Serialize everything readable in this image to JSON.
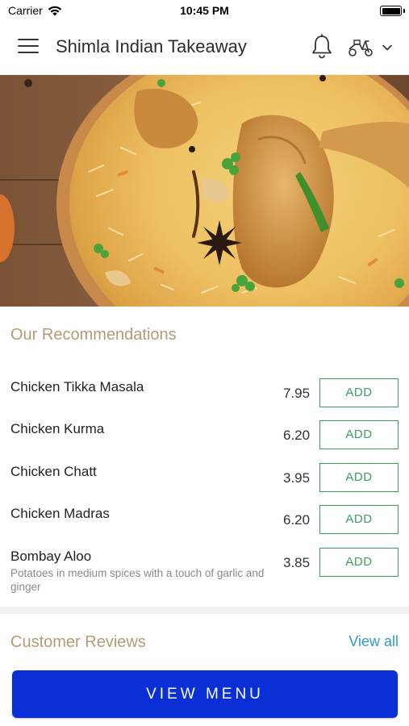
{
  "status_bar": {
    "carrier": "Carrier",
    "time": "10:45 PM"
  },
  "header": {
    "title": "Shimla Indian Takeaway",
    "icons": [
      "menu-icon",
      "bell-icon",
      "scooter-icon",
      "chevron-down-icon"
    ]
  },
  "hero": {
    "image": "chicken biryani dish"
  },
  "recommendations": {
    "title": "Our Recommendations",
    "add_label": "ADD",
    "items": [
      {
        "name": "Chicken Tikka Masala",
        "price": "7.95",
        "description": ""
      },
      {
        "name": "Chicken Kurma",
        "price": "6.20",
        "description": ""
      },
      {
        "name": "Chicken Chatt",
        "price": "3.95",
        "description": ""
      },
      {
        "name": "Chicken Madras",
        "price": "6.20",
        "description": ""
      },
      {
        "name": "Bombay Aloo",
        "price": "3.85",
        "description": "Potatoes in medium spices with a touch of garlic and ginger"
      }
    ]
  },
  "reviews": {
    "title": "Customer Reviews",
    "view_all": "View all"
  },
  "footer": {
    "view_menu": "VIEW MENU"
  },
  "colors": {
    "accent_blue": "#0a2fd6",
    "add_green": "#3a9e5c",
    "section_title": "#b39b78",
    "link_blue": "#2a9ecf"
  }
}
